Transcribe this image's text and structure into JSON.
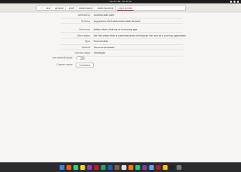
{
  "topbar": {
    "clock": "Thu 15:38 - 10:15:40"
  },
  "breadcrumb": {
    "segments": [
      "/",
      "org",
      "gnome",
      "shell",
      "extensions",
      "dash-to-dock",
      "click-action"
    ],
    "active_index": 6
  },
  "details": {
    "rows": [
      {
        "label": "Defined by",
        "value": "Schema with path"
      },
      {
        "label": "Schema",
        "value": "org.gnome.shell.extensions.dash-to-dock"
      },
      {
        "label": "Summary",
        "value": "Action when clicking on a running app"
      },
      {
        "label": "Description",
        "value": "Set the action that is executed when clicking on the icon of a running application"
      },
      {
        "label": "Type",
        "value": "Enumeration"
      },
      {
        "label": "Default",
        "value": "'focus-or-previews'"
      },
      {
        "label": "Current value",
        "value": "'minimize'"
      }
    ]
  },
  "controls": {
    "use_default_label": "Use default value",
    "use_default_on": false,
    "custom_label": "Custom value",
    "custom_value": "'minimize'"
  },
  "colors": {
    "accent": "#e01b24",
    "dock_icons": [
      "#3584e4",
      "#e66100",
      "#33d17a",
      "#f6d32d",
      "#9141ac",
      "#c01c28",
      "#26a269",
      "#1a5fb4",
      "#865e3c",
      "#deddda",
      "#ff7800",
      "#2ec27e",
      "#813d9c",
      "#62a0ea",
      "#a51d2d",
      "#f5c211",
      "#241f31",
      "#77767b"
    ]
  }
}
